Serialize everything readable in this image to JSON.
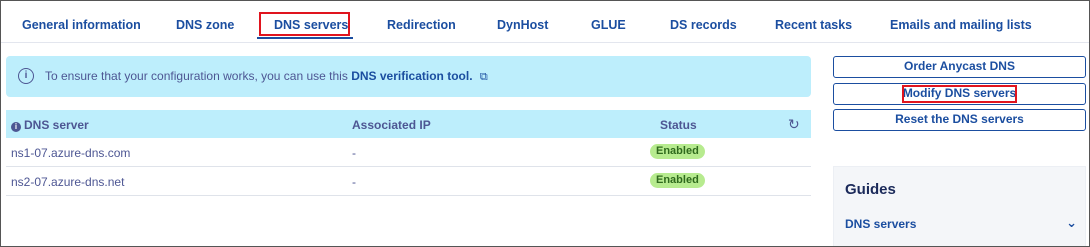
{
  "tabs": [
    {
      "label": "General information"
    },
    {
      "label": "DNS zone"
    },
    {
      "label": "DNS servers"
    },
    {
      "label": "Redirection"
    },
    {
      "label": "DynHost"
    },
    {
      "label": "GLUE"
    },
    {
      "label": "DS records"
    },
    {
      "label": "Recent tasks"
    },
    {
      "label": "Emails and mailing lists"
    }
  ],
  "active_tab": "DNS servers",
  "banner": {
    "text": "To ensure that your configuration works, you can use this",
    "link": "DNS verification tool.",
    "icon": "info-circle-icon",
    "link_icon": "external-link-icon"
  },
  "table": {
    "columns": [
      "DNS server",
      "Associated IP",
      "Status"
    ],
    "header_icon": "info-circle-icon",
    "refresh_icon": "refresh-icon",
    "rows": [
      {
        "server": "ns1-07.azure-dns.com",
        "ip": "-",
        "status": "Enabled"
      },
      {
        "server": "ns2-07.azure-dns.net",
        "ip": "-",
        "status": "Enabled"
      }
    ]
  },
  "actions": {
    "order_anycast": "Order Anycast DNS",
    "modify": "Modify DNS servers",
    "reset": "Reset the DNS servers"
  },
  "guides": {
    "title": "Guides",
    "item": "DNS servers",
    "chevron_icon": "chevron-down-icon"
  },
  "colors": {
    "accent": "#1b4ea0",
    "banner_bg": "#bdeefc",
    "highlight": "#e0141e",
    "badge_bg": "#b7eb8f"
  }
}
